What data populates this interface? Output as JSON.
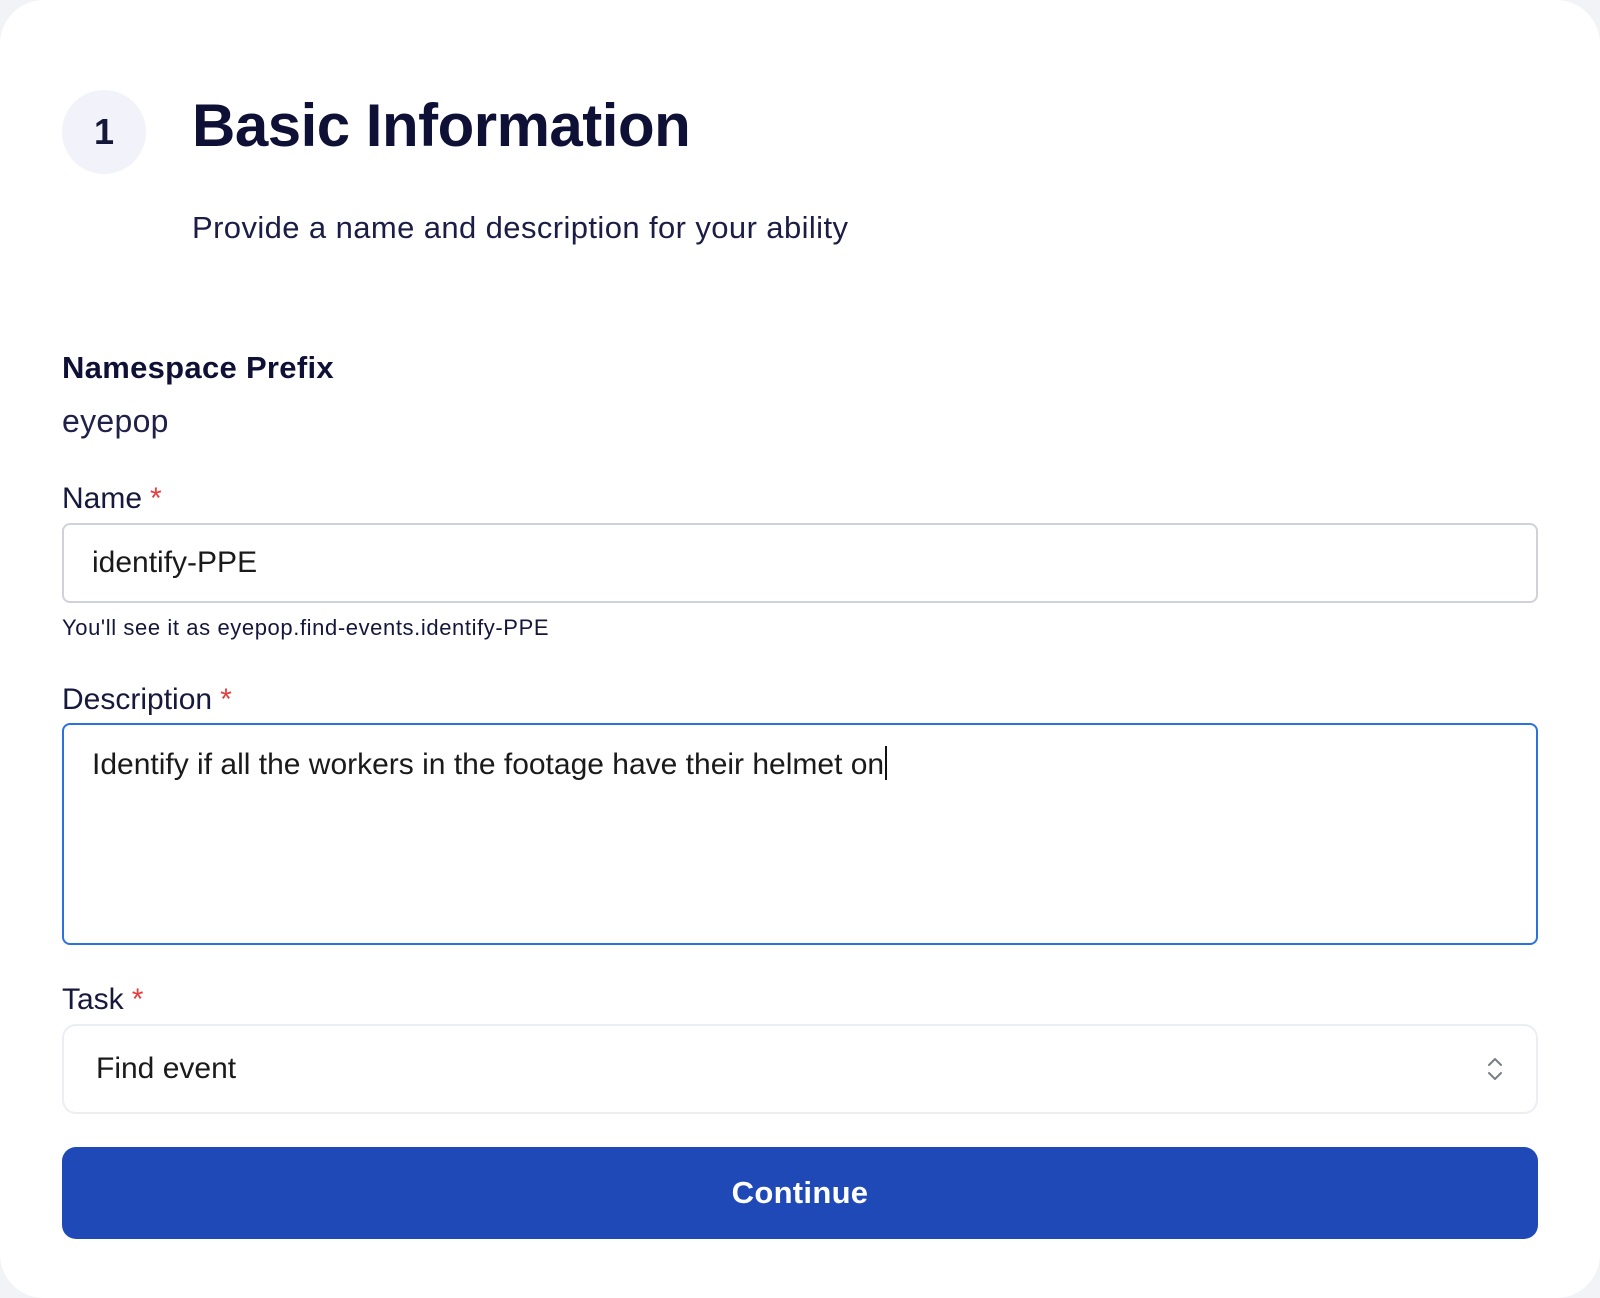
{
  "step": {
    "number": "1",
    "title": "Basic Information",
    "subtitle": "Provide a name and description for your ability"
  },
  "namespace": {
    "label": "Namespace Prefix",
    "value": "eyepop"
  },
  "name_field": {
    "label": "Name",
    "required_mark": "*",
    "value": "identify-PPE",
    "helper": "You'll see it as eyepop.find-events.identify-PPE"
  },
  "description_field": {
    "label": "Description",
    "required_mark": "*",
    "value": "Identify if all the workers in the footage have their helmet on"
  },
  "task_field": {
    "label": "Task",
    "required_mark": "*",
    "selected": "Find event"
  },
  "actions": {
    "continue_label": "Continue"
  },
  "icons": {
    "select": "chevron-up-down-icon"
  },
  "colors": {
    "primary": "#1e49b6",
    "focus_border": "#2b72e0",
    "required": "#e53e3e",
    "heading": "#0e1035"
  }
}
